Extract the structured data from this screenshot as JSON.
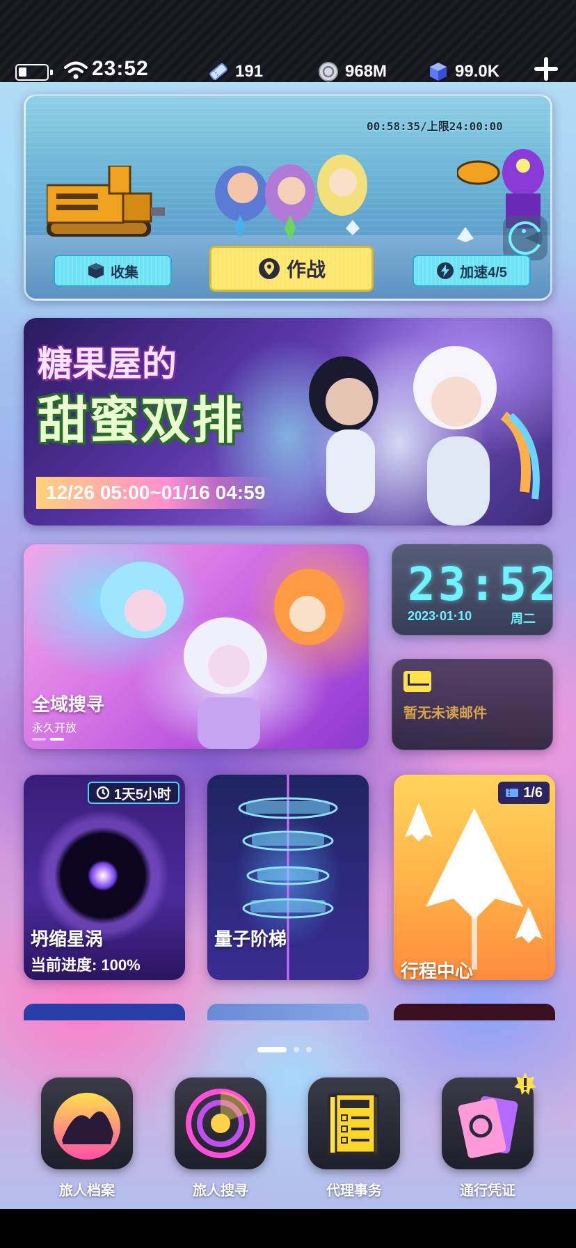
{
  "status_bar": {
    "time": "23:52",
    "resources": [
      {
        "icon": "ticket-icon",
        "value": "191"
      },
      {
        "icon": "coin-icon",
        "value": "968M"
      },
      {
        "icon": "cube-gem-icon",
        "value": "99.0K"
      }
    ]
  },
  "expedition": {
    "timer": "00:58:35/上限24:00:00",
    "collect_label": "收集",
    "battle_label": "作战",
    "speed_label": "加速4/5"
  },
  "event_banner": {
    "title_line1": "糖果屋的",
    "title_line2": "甜蜜双排",
    "date_range": "12/26 05:00~01/16 04:59"
  },
  "search_card": {
    "title": "全域搜寻",
    "subtitle": "永久开放"
  },
  "clock_widget": {
    "time": "23:52",
    "date": "2023·01·10",
    "weekday": "周二"
  },
  "mail_widget": {
    "text": "暂无未读邮件"
  },
  "tiles": {
    "void": {
      "title": "坍缩星涡",
      "progress_text": "当前进度: 100%",
      "badge": "1天5小时"
    },
    "quantum": {
      "title": "量子阶梯"
    },
    "trip": {
      "title": "行程中心",
      "badge": "1/6"
    }
  },
  "pager": {
    "pages": 3,
    "current": 0
  },
  "dock": [
    {
      "label": "旅人档案",
      "icon": "traveler-archives-icon"
    },
    {
      "label": "旅人搜寻",
      "icon": "radar-icon"
    },
    {
      "label": "代理事务",
      "icon": "task-list-icon"
    },
    {
      "label": "通行凭证",
      "icon": "pass-card-icon"
    }
  ],
  "colors": {
    "accent_cyan": "#6ff4ff",
    "battle_yellow": "#ffe66a",
    "mail_gold": "#d9a34a"
  }
}
